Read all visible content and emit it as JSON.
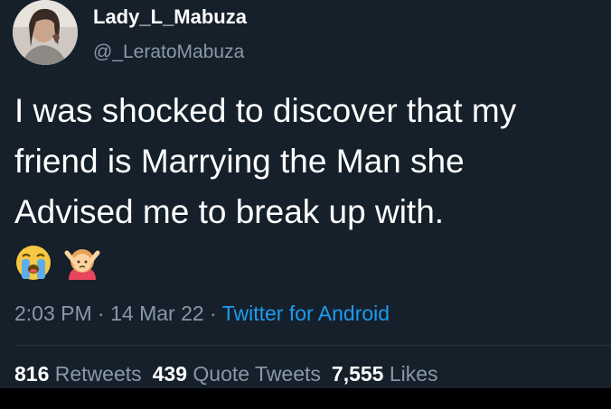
{
  "tweet": {
    "author": {
      "display_name": "Lady_L_Mabuza",
      "username": "@_LeratoMabuza"
    },
    "text_lines": [
      "I was shocked to discover that my",
      "friend is Marrying the Man she",
      "Advised me to break up with."
    ],
    "emojis": [
      "loudly-crying-face-icon",
      "person-gesturing-no-icon"
    ],
    "meta": {
      "time": "2:03 PM",
      "separator": " · ",
      "date": "14 Mar 22",
      "source": "Twitter for Android"
    },
    "stats": {
      "retweets_count": "816",
      "retweets_label": "Retweets",
      "quotes_count": "439",
      "quotes_label": "Quote Tweets",
      "likes_count": "7,555",
      "likes_label": "Likes"
    }
  },
  "colors": {
    "background": "#15202b",
    "text_primary": "#ffffff",
    "text_secondary": "#8899a6",
    "link": "#1d9bf0",
    "divider": "#253341"
  }
}
